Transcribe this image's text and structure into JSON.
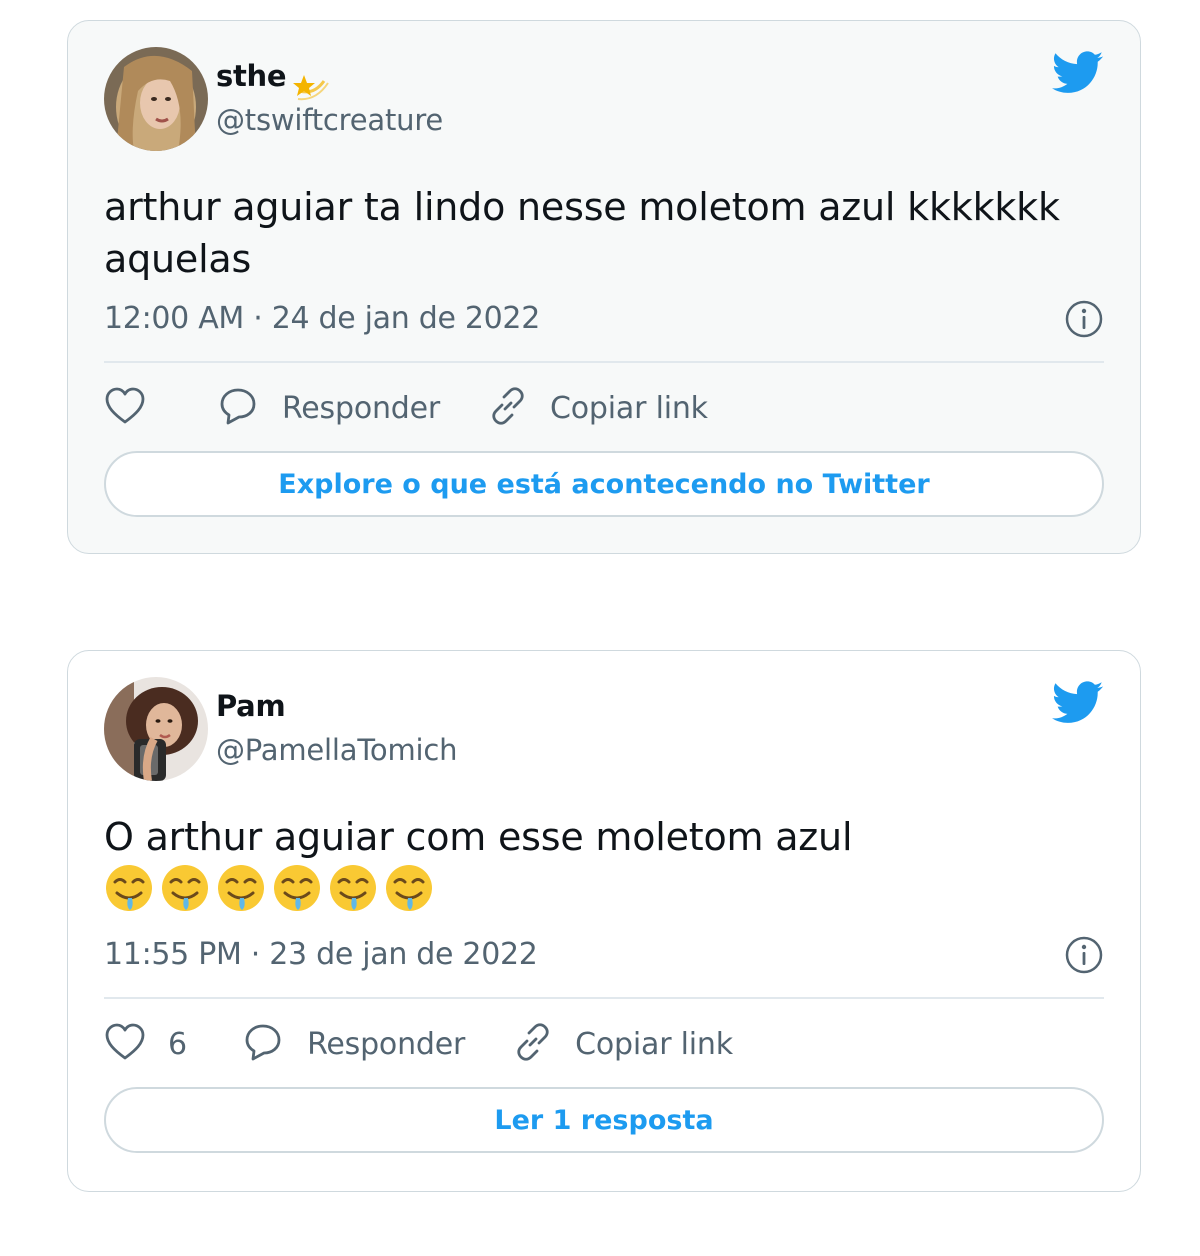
{
  "tweets": [
    {
      "author_name": "sthe",
      "name_emoji": "shooting-star",
      "author_handle": "@tswiftcreature",
      "text": "arthur aguiar ta lindo nesse moletom azul kkkkkkk aquelas",
      "timestamp": "12:00 AM · 24 de jan de 2022",
      "like_count": "",
      "reply_label": "Responder",
      "copy_link_label": "Copiar link",
      "cta_label": "Explore o que está acontecendo no Twitter"
    },
    {
      "author_name": "Pam",
      "author_handle": "@PamellaTomich",
      "text": "O arthur aguiar com esse moletom azul",
      "text_emoji": "drooling-face",
      "text_emoji_count": 6,
      "timestamp": "11:55 PM · 23 de jan de 2022",
      "like_count": "6",
      "reply_label": "Responder",
      "copy_link_label": "Copiar link",
      "cta_label": "Ler 1 resposta"
    }
  ],
  "colors": {
    "twitter_blue": "#1d9bf0",
    "secondary_text": "#536471",
    "card_border": "#cfd9de"
  },
  "icons": [
    "twitter-bird-icon",
    "heart-icon",
    "reply-bubble-icon",
    "link-icon",
    "info-icon"
  ]
}
